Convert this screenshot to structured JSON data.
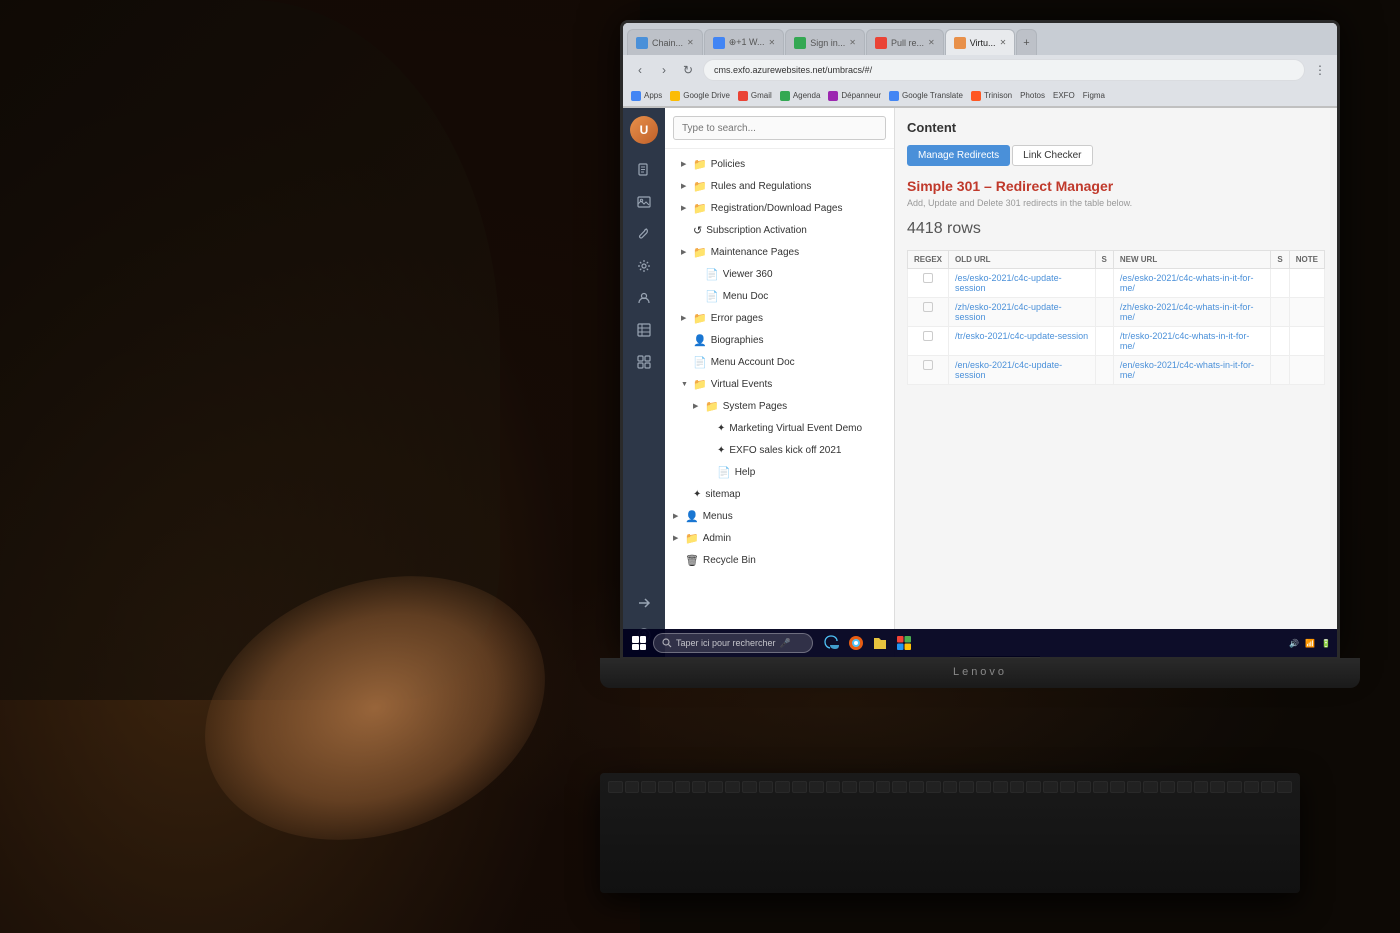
{
  "photo": {
    "bg_description": "Person at laptop in dark environment"
  },
  "browser": {
    "tabs": [
      {
        "label": "Chain...",
        "active": false,
        "favicon_color": "#4a90d9"
      },
      {
        "label": "⊕+1 W...",
        "active": false,
        "favicon_color": "#4285f4"
      },
      {
        "label": "Sign in...",
        "active": false,
        "favicon_color": "#34a853"
      },
      {
        "label": "Pull re...",
        "active": false,
        "favicon_color": "#ea4335"
      },
      {
        "label": "Virtu...",
        "active": true,
        "favicon_color": "#e8904a"
      }
    ],
    "address": "cms.exfo.azurewebsites.net/umbracs/#/",
    "bookmarks": [
      "Apps",
      "Google Drive",
      "Gmail",
      "Agenda",
      "Dépanneur",
      "Google Translate",
      "Trinison",
      "Photos",
      "EXFO",
      "Figma"
    ]
  },
  "cms": {
    "search_placeholder": "Type to search...",
    "tree_items": [
      {
        "label": "Policies",
        "indent": 1,
        "type": "folder",
        "expanded": false
      },
      {
        "label": "Rules and Regulations",
        "indent": 1,
        "type": "folder",
        "expanded": false
      },
      {
        "label": "Registration/Download Pages",
        "indent": 1,
        "type": "folder",
        "expanded": false
      },
      {
        "label": "Subscription Activation",
        "indent": 1,
        "type": "item",
        "expanded": false
      },
      {
        "label": "Maintenance Pages",
        "indent": 1,
        "type": "folder",
        "expanded": false
      },
      {
        "label": "Viewer 360",
        "indent": 2,
        "type": "doc",
        "expanded": false
      },
      {
        "label": "Menu Doc",
        "indent": 2,
        "type": "doc",
        "expanded": false
      },
      {
        "label": "Error pages",
        "indent": 1,
        "type": "folder",
        "expanded": false
      },
      {
        "label": "Biographies",
        "indent": 1,
        "type": "people",
        "expanded": false
      },
      {
        "label": "Menu Account Doc",
        "indent": 1,
        "type": "doc",
        "expanded": false
      },
      {
        "label": "Virtual Events",
        "indent": 1,
        "type": "folder",
        "expanded": true
      },
      {
        "label": "System Pages",
        "indent": 2,
        "type": "folder",
        "expanded": false
      },
      {
        "label": "Marketing Virtual Event Demo",
        "indent": 3,
        "type": "special",
        "expanded": false
      },
      {
        "label": "EXFO sales kick off 2021",
        "indent": 3,
        "type": "special",
        "expanded": false
      },
      {
        "label": "Help",
        "indent": 3,
        "type": "doc",
        "expanded": false
      },
      {
        "label": "sitemap",
        "indent": 1,
        "type": "special",
        "expanded": false
      },
      {
        "label": "Menus",
        "indent": 0,
        "type": "people",
        "expanded": false
      },
      {
        "label": "Admin",
        "indent": 0,
        "type": "folder",
        "expanded": false
      },
      {
        "label": "Recycle Bin",
        "indent": 0,
        "type": "folder",
        "expanded": false
      }
    ],
    "sidebar_icons": [
      "document",
      "image",
      "wrench",
      "settings",
      "person",
      "table",
      "grid",
      "arrow-right",
      "question"
    ],
    "content": {
      "header": "Content",
      "tabs": [
        "Manage Redirects",
        "Link Checker"
      ],
      "active_tab": "Manage Redirects",
      "title": "Simple 301 – Redirect Manager",
      "description": "Add, Update and Delete 301 redirects in the table below.",
      "rows_count": "4418 rows",
      "table_headers": [
        "REGEX",
        "OLD URL",
        "S",
        "NEW URL",
        "S",
        "NOTE"
      ],
      "table_rows": [
        {
          "old_url": "/es/esko-2021/c4c-update-session",
          "new_url": "/es/esko-2021/c4c-whats-in-it-for-me/"
        },
        {
          "old_url": "/zh/esko-2021/c4c-update-session",
          "new_url": "/zh/esko-2021/c4c-whats-in-it-for-me/"
        },
        {
          "old_url": "/tr/esko-2021/c4c-update-session",
          "new_url": "/tr/esko-2021/c4c-whats-in-it-for-me/"
        },
        {
          "old_url": "/en/esko-2021/c4c-update-session",
          "new_url": "/en/esko-2021/c4c-whats-in-it-for-me/"
        }
      ]
    }
  },
  "taskbar": {
    "search_placeholder": "Taper ici pour rechercher",
    "time": "►",
    "apps": [
      "🌐",
      "🦊",
      "📁",
      "⚙",
      "🎵"
    ]
  }
}
